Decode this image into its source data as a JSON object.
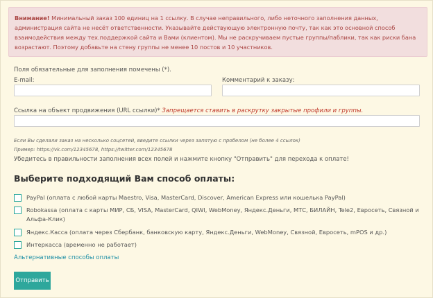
{
  "alert": {
    "title": "Внимание!",
    "text": "Минимальный заказ 100 единиц на 1 ссылку. В случае неправильного, либо неточного заполнения данных, администрация сайта не несёт ответственности. Указывайте действующую электронную почту, так как это основной способ взаимодействия между тех.поддержкой сайта и Вами (клиентом). Мы не раскручиваем пустые группы/паблики, так как риски бана возрастают. Поэтому добавьте на стену группы не менее 10 постов и 10 участников."
  },
  "form": {
    "required_note": "Поля обязательные для заполнения помечены (*).",
    "email_label": "E-mail:",
    "email_value": "",
    "comment_label": "Комментарий к заказу:",
    "comment_value": "",
    "url_label": "Ссылка на объект продвижения (URL ссылки)*",
    "url_warning": "Запрещается ставить в раскрутку закрытые профили и группы.",
    "url_value": "",
    "note_multi": "Если Вы сделали заказ на несколько соцсетей, введите ссылки через запятую с пробелом (не более 4 ссылок)",
    "note_example": "Пример: https://vk.com/12345678, https://twitter.com/12345678",
    "check_text": "Убедитесь в правильности заполнения всех полей и нажмите кнопку \"Отправить\" для перехода к оплате!"
  },
  "payment": {
    "heading": "Выберите подходящий Вам способ оплаты:",
    "options": [
      {
        "label": "PayPal (оплата с любой карты Maestro, Visa, MasterCard, Discover, American Express или кошелька PayPal)",
        "checked": false
      },
      {
        "label": "Robokassa (оплата с карты МИР, СБ, VISA, MasterCard, QIWI, WebMoney, Яндекс.Деньги, МТС, БИЛАЙН, Tele2, Евросеть, Связной и Альфа-Клик)",
        "checked": false
      },
      {
        "label": "Яндекс.Касса (оплата через Сбербанк, банковскую карту, Яндекс.Деньги, WebMoney, Связной, Евросеть, mPOS и др.)",
        "checked": false
      },
      {
        "label": "Интеркасса (временно не работает)",
        "checked": false
      }
    ],
    "alt_link": "Альтернативные способы оплаты",
    "submit_label": "Отправить"
  },
  "colors": {
    "background": "#fdf8e4",
    "alert_bg": "#f2dede",
    "alert_text": "#a94442",
    "accent": "#2ea79c",
    "link": "#1e8fa6"
  }
}
